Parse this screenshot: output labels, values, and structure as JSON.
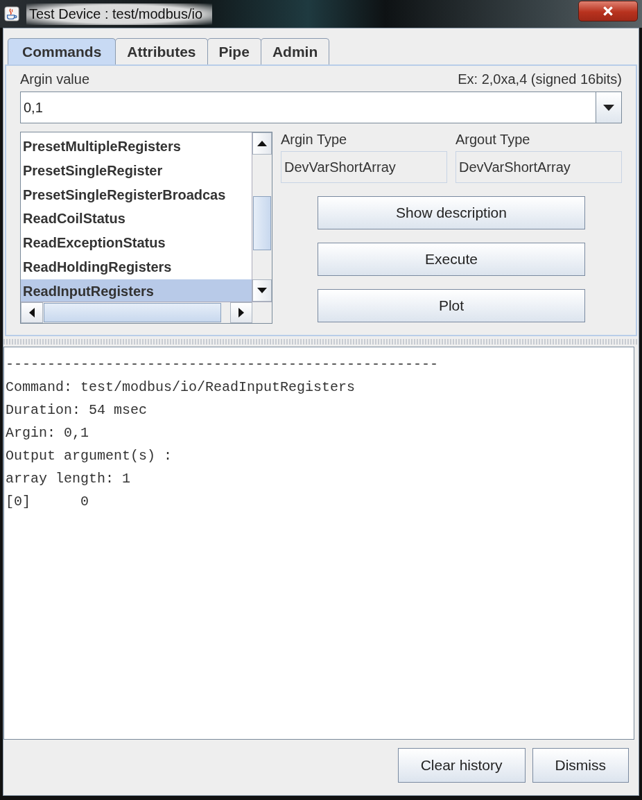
{
  "window": {
    "title": "Test Device : test/modbus/io"
  },
  "tabs": [
    {
      "label": "Commands",
      "selected": true
    },
    {
      "label": "Attributes",
      "selected": false
    },
    {
      "label": "Pipe",
      "selected": false
    },
    {
      "label": "Admin",
      "selected": false
    }
  ],
  "argin": {
    "label": "Argin value",
    "hint": "Ex: 2,0xa,4 (signed 16bits)",
    "value": "0,1"
  },
  "commands": [
    {
      "label": "PresetMultipleRegisters",
      "selected": false
    },
    {
      "label": "PresetSingleRegister",
      "selected": false
    },
    {
      "label": "PresetSingleRegisterBroadcas",
      "selected": false
    },
    {
      "label": "ReadCoilStatus",
      "selected": false
    },
    {
      "label": "ReadExceptionStatus",
      "selected": false
    },
    {
      "label": "ReadHoldingRegisters",
      "selected": false
    },
    {
      "label": "ReadInputRegisters",
      "selected": true
    }
  ],
  "argin_type": {
    "label": "Argin Type",
    "value": "DevVarShortArray"
  },
  "argout_type": {
    "label": "Argout Type",
    "value": "DevVarShortArray"
  },
  "actions": [
    "Show description",
    "Execute",
    "Plot"
  ],
  "output": [
    "----------------------------------------------------",
    "Command: test/modbus/io/ReadInputRegisters",
    "Duration: 54 msec",
    "Argin: 0,1",
    "Output argument(s) :",
    "array length: 1",
    "[0]      0"
  ],
  "footer_buttons": [
    "Clear history",
    "Dismiss"
  ]
}
